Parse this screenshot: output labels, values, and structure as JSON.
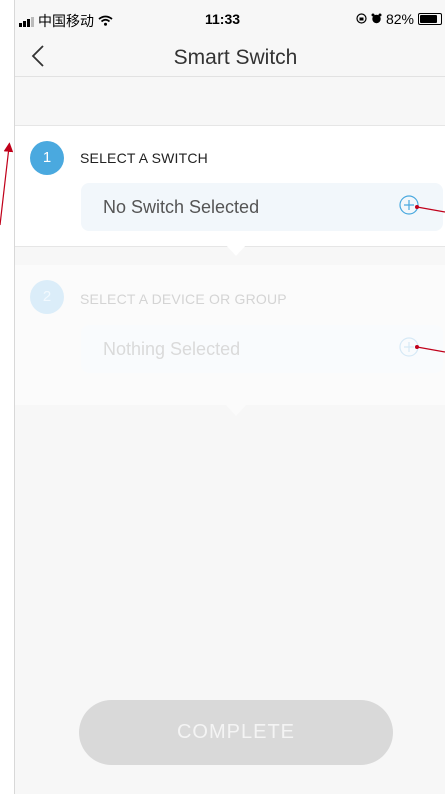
{
  "status_bar": {
    "carrier": "中国移动",
    "time": "11:33",
    "battery": "82%"
  },
  "nav": {
    "back_icon": "chevron-left-icon",
    "title": "Smart Switch"
  },
  "steps": [
    {
      "number": "1",
      "title": "SELECT A SWITCH",
      "value": "No Switch Selected",
      "state": "active"
    },
    {
      "number": "2",
      "title": "SELECT A DEVICE OR GROUP",
      "value": "Nothing Selected",
      "state": "disabled"
    }
  ],
  "complete_button": {
    "label": "COMPLETE",
    "state": "disabled"
  },
  "colors": {
    "accent": "#4aa9df",
    "annotation": "#c0001a",
    "disabled_button": "#d9d9d9"
  }
}
